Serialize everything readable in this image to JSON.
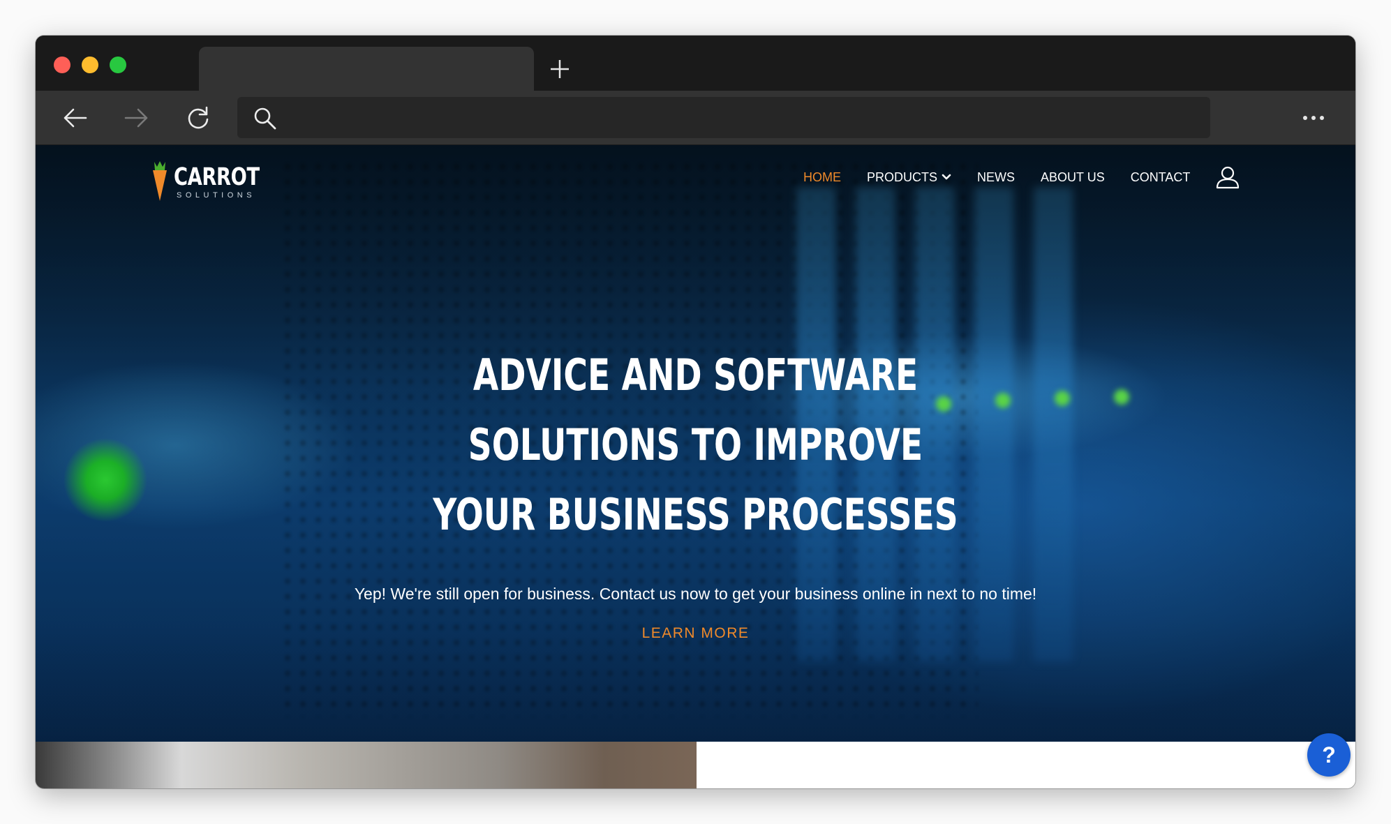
{
  "browser": {
    "tab_title": "",
    "new_tab_icon": "plus-icon",
    "back_icon": "arrow-left-icon",
    "forward_icon": "arrow-right-icon",
    "reload_icon": "reload-icon",
    "address_value": "",
    "search_icon": "search-icon",
    "menu_icon": "more-horizontal-icon",
    "traffic_lights": [
      "#fe5f57",
      "#febc2e",
      "#28c840"
    ]
  },
  "site": {
    "logo": {
      "name": "CARROT",
      "tagline": "SOLUTIONS"
    },
    "nav": {
      "home": "HOME",
      "products": "PRODUCTS",
      "news": "NEWS",
      "about": "ABOUT US",
      "contact": "CONTACT"
    },
    "hero": {
      "headline_lines": [
        "ADVICE AND SOFTWARE",
        "SOLUTIONS TO IMPROVE",
        "YOUR BUSINESS PROCESSES"
      ],
      "subtext": "Yep! We're still open for business.  Contact us now to get your business online in next to no time!",
      "cta": "LEARN MORE"
    },
    "help_button": "?",
    "colors": {
      "accent": "#f08a2a",
      "help": "#1a5fd6"
    }
  }
}
